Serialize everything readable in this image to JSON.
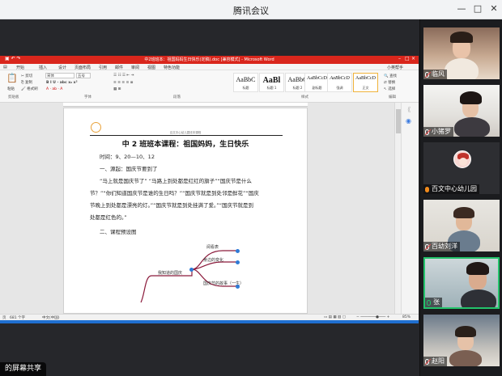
{
  "window": {
    "title": "腾讯会议",
    "controls": {
      "minimize": "—",
      "maximize": "□",
      "close": "✕"
    }
  },
  "word": {
    "title": "中2班班本：祖国妈妈生日快乐(定稿).doc [兼容模式] - Microsoft Word",
    "menu": [
      "开始",
      "插入",
      "设计",
      "页面布局",
      "引用",
      "邮件",
      "审阅",
      "视图",
      "特色功能"
    ],
    "help_label": "小英帮手",
    "ribbon": {
      "paste": "粘贴",
      "font_name": "宋体",
      "font_size": "五号",
      "clipboard_group": "剪贴板",
      "font_group": "字体",
      "paragraph_group": "段落",
      "styles_group": "样式",
      "edit_group": "编辑",
      "styles": [
        {
          "sample": "AaBbC",
          "name": "标题"
        },
        {
          "sample": "AaBl",
          "name": "标题 1"
        },
        {
          "sample": "AaBbC",
          "name": "标题 2"
        },
        {
          "sample": "AaBbCcD",
          "name": "副标题"
        },
        {
          "sample": "AaBbCcD",
          "name": "强调"
        },
        {
          "sample": "AaBbCcD",
          "name": "正文"
        }
      ]
    },
    "document": {
      "header_text": "百文中心幼儿园班本课程",
      "title": "中 2 班班本课程：祖国妈妈，生日快乐",
      "paragraphs": [
        "时间：9、20—10、12",
        "一、源起：国庆节要到了",
        "“马上就是国庆节了” “马路上到处都是红红的旗子”“国庆节是什么",
        "节？”“你们知道国庆节是谁的生日吗？”“国庆节就是到处邻是鲜花”“国庆",
        "节晚上到处都是漂亮的灯。”“国庆节就是到处挂满了爱。”“国庆节就是到",
        "处都是红色的。”",
        "二、课程预设图"
      ],
      "mindmap": {
        "root": "我知道的国庆",
        "branches": [
          "阅看表",
          "身边的变化",
          "国庆节的故事（一生）"
        ]
      }
    },
    "status": {
      "page": "页",
      "words": "681 个字",
      "lang": "中文(中国)",
      "zoom": "85%"
    }
  },
  "share_badge": "的屏幕共享",
  "participants": [
    {
      "name": "临风",
      "muted": true
    },
    {
      "name": "小猪罗",
      "muted": true
    },
    {
      "name": "百文中心幼儿园",
      "muted": false,
      "avatar": true
    },
    {
      "name": "百幼刘洋",
      "muted": true
    },
    {
      "name": "张",
      "muted": false,
      "active": true
    },
    {
      "name": "赵阳",
      "muted": true
    }
  ],
  "colors": {
    "word_red": "#d9261c",
    "active_border": "#23c36b",
    "gallery_bg": "#1b1c1f"
  }
}
